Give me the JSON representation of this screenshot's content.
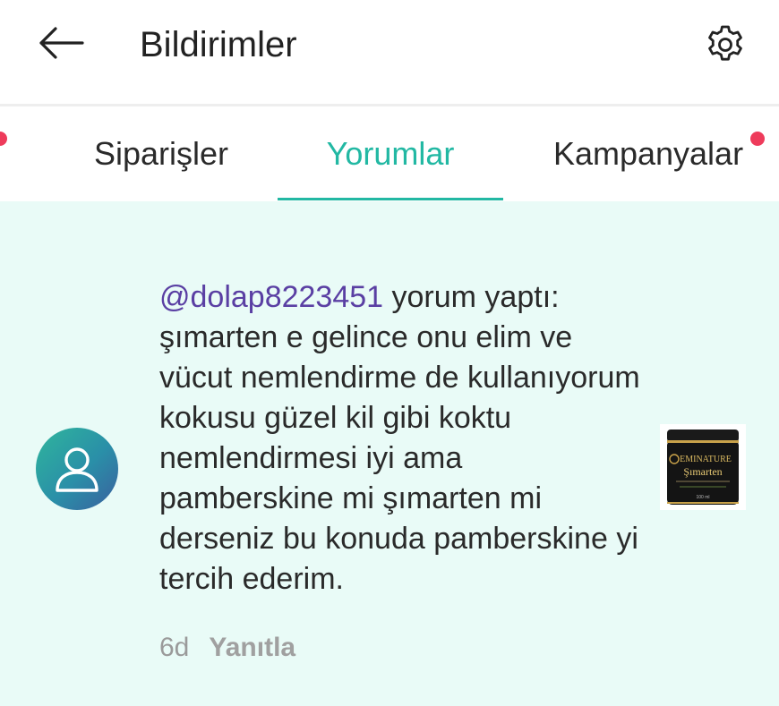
{
  "header": {
    "title": "Bildirimler",
    "back_icon": "arrow-left-icon",
    "settings_icon": "gear-icon"
  },
  "tabs": [
    {
      "label": "Siparişler",
      "active": false,
      "has_dot": true
    },
    {
      "label": "Yorumlar",
      "active": true,
      "has_dot": false
    },
    {
      "label": "Kampanyalar",
      "active": false,
      "has_dot": true
    }
  ],
  "colors": {
    "accent": "#22b8a3",
    "notification_dot": "#ee3b5b",
    "content_bg": "#e9fbf7",
    "username": "#5a3fa3"
  },
  "notification": {
    "username": "@dolap8223451",
    "action": " yorum yaptı:",
    "text": "şımarten e gelince onu elim ve vücut nemlendirme de kullanıyorum kokusu güzel kil gibi koktu nemlendirmesi iyi ama pamberskine mi şımarten mi derseniz bu konuda pamberskine yi tercih ederim.",
    "time": "6d",
    "reply_label": "Yanıtla",
    "avatar_icon": "user-icon",
    "product": {
      "brand": "EMINATURE",
      "name": "Şımarten",
      "volume": "100 ml"
    }
  }
}
